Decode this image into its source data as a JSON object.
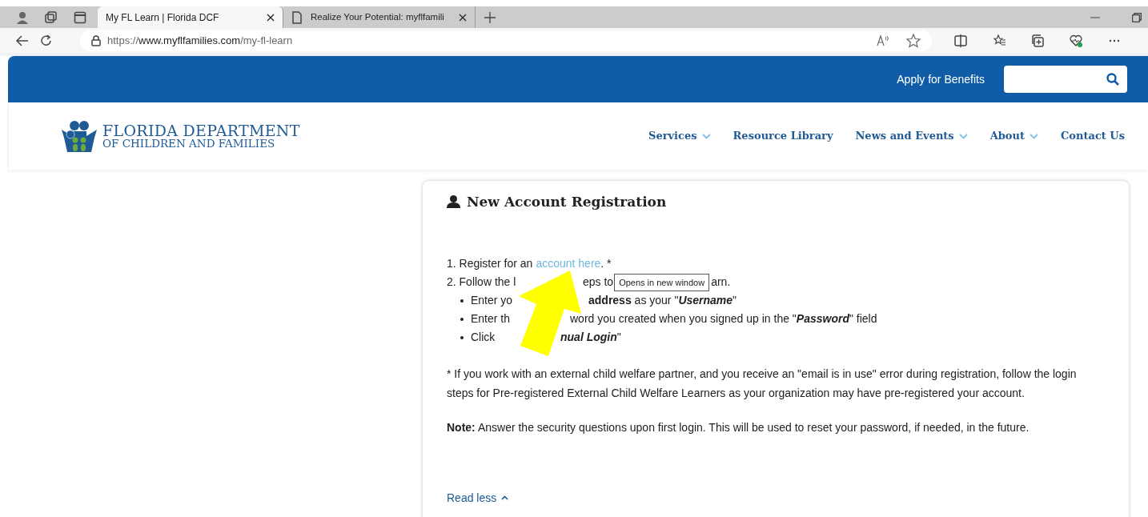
{
  "browser": {
    "tabs": [
      {
        "title": "My FL Learn | Florida DCF",
        "selected": true,
        "kind": "site"
      },
      {
        "title": "Realize Your Potential: myflfamili",
        "selected": false,
        "kind": "page"
      }
    ],
    "url_scheme": "https://",
    "url_host": "www.myflfamilies.com",
    "url_path": "/my-fl-learn"
  },
  "topbar": {
    "apply_link": "Apply for Benefits"
  },
  "logo": {
    "line1": "FLORIDA DEPARTMENT",
    "line2": "OF CHILDREN AND FAMILIES"
  },
  "nav": [
    {
      "label": "Services",
      "dropdown": true
    },
    {
      "label": "Resource Library",
      "dropdown": false
    },
    {
      "label": "News and Events",
      "dropdown": true
    },
    {
      "label": "About",
      "dropdown": true
    },
    {
      "label": "Contact Us",
      "dropdown": false
    }
  ],
  "card": {
    "title": "New Account Registration",
    "lines": [
      {
        "kind": "numbered",
        "parts": [
          {
            "kind": "text",
            "text": "1. Register for an"
          },
          {
            "kind": "link",
            "text": "account here"
          },
          {
            "kind": "text",
            "text": ". *"
          }
        ]
      },
      {
        "kind": "numbered",
        "parts": [
          {
            "kind": "text",
            "text": "2. Follow the l"
          },
          {
            "kind": "text",
            "text": "eps to"
          },
          {
            "kind": "tooltip",
            "text": "Opens in new window"
          },
          {
            "kind": "text",
            "text": "arn."
          }
        ]
      },
      {
        "kind": "bullet",
        "parts": [
          {
            "kind": "text",
            "text": "Enter yo"
          },
          {
            "kind": "rich",
            "text": "**address** as your \"*Username*\""
          }
        ]
      },
      {
        "kind": "bullet",
        "parts": [
          {
            "kind": "text",
            "text": "Enter th"
          },
          {
            "kind": "rich",
            "text": "word you created when you signed up in the \"*Password*\" field"
          }
        ]
      },
      {
        "kind": "bullet",
        "parts": [
          {
            "kind": "text",
            "text": "Click"
          },
          {
            "kind": "rich",
            "text": "*nual Login*\""
          }
        ]
      }
    ],
    "footnote": "* If you work with an external child welfare partner, and you receive an \"email is in use\" error during registration, follow the login steps for Pre-registered External Child Welfare Learners as your organization may have pre-registered your account.",
    "note": "**Note:** Answer the security questions upon first login. This will be used to reset your password, if needed, in the future.",
    "toggle": "Read less",
    "expanded": true
  }
}
